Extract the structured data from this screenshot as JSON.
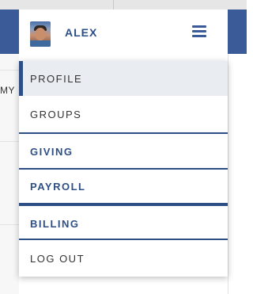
{
  "user": {
    "name": "ALEX"
  },
  "background": {
    "fragment": "MY"
  },
  "menu": {
    "items": [
      {
        "label": "PROFILE",
        "active": true
      },
      {
        "label": "GROUPS"
      },
      {
        "label": "GIVING"
      },
      {
        "label": "PAYROLL"
      },
      {
        "label": "BILLING"
      },
      {
        "label": "LOG OUT"
      }
    ]
  },
  "colors": {
    "brand": "#3a5b97",
    "menu_accent": "#2e4f86",
    "active_bg": "#e9edf2"
  }
}
